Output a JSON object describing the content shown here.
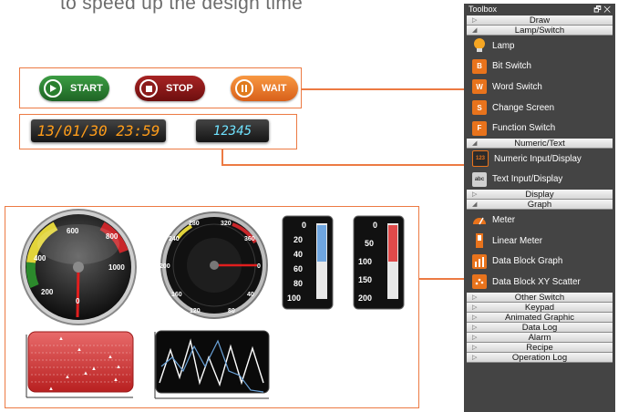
{
  "headline": "to speed up the design time",
  "buttons": {
    "start": "START",
    "stop": "STOP",
    "wait": "WAIT"
  },
  "displays": {
    "datetime": "13/01/30 23:59",
    "number": "12345"
  },
  "gauges": {
    "gauge1_ticks": [
      "600",
      "800",
      "400",
      "1000",
      "200",
      "0"
    ],
    "gauge2_ticks": [
      "280",
      "320",
      "240",
      "360",
      "200",
      "0",
      "160",
      "40",
      "120",
      "80"
    ],
    "linear1_ticks": [
      "0",
      "20",
      "40",
      "60",
      "80",
      "100"
    ],
    "linear2_ticks": [
      "0",
      "50",
      "100",
      "150",
      "200"
    ]
  },
  "toolbox": {
    "title": "Toolbox",
    "window_controls": "🗗 ✕",
    "sections": [
      {
        "label": "Draw",
        "expanded": false
      },
      {
        "label": "Lamp/Switch",
        "expanded": true,
        "items": [
          {
            "label": "Lamp",
            "icon": "lamp-icon"
          },
          {
            "label": "Bit Switch",
            "icon": "bit-switch-icon",
            "glyph": "B"
          },
          {
            "label": "Word Switch",
            "icon": "word-switch-icon",
            "glyph": "W"
          },
          {
            "label": "Change Screen",
            "icon": "change-screen-icon",
            "glyph": "S"
          },
          {
            "label": "Function Switch",
            "icon": "function-switch-icon",
            "glyph": "F"
          }
        ]
      },
      {
        "label": "Numeric/Text",
        "expanded": true,
        "items": [
          {
            "label": "Numeric Input/Display",
            "icon": "numeric-display-icon",
            "glyph": "123"
          },
          {
            "label": "Text Input/Display",
            "icon": "text-display-icon",
            "glyph": "abc"
          }
        ]
      },
      {
        "label": "Display",
        "expanded": false
      },
      {
        "label": "Graph",
        "expanded": true,
        "items": [
          {
            "label": "Meter",
            "icon": "meter-icon"
          },
          {
            "label": "Linear Meter",
            "icon": "linear-meter-icon"
          },
          {
            "label": "Data Block Graph",
            "icon": "data-block-graph-icon"
          },
          {
            "label": "Data Block XY Scatter",
            "icon": "xy-scatter-icon"
          }
        ]
      },
      {
        "label": "Other Switch",
        "expanded": false
      },
      {
        "label": "Keypad",
        "expanded": false
      },
      {
        "label": "Animated Graphic",
        "expanded": false
      },
      {
        "label": "Data Log",
        "expanded": false
      },
      {
        "label": "Alarm",
        "expanded": false
      },
      {
        "label": "Recipe",
        "expanded": false
      },
      {
        "label": "Operation Log",
        "expanded": false
      }
    ]
  },
  "colors": {
    "accent_line": "#ec7a43",
    "start": "#2e7d32",
    "stop": "#8e1616",
    "wait": "#e8731c",
    "led_orange": "#ff9d1a",
    "led_cyan": "#6fe3ff"
  }
}
